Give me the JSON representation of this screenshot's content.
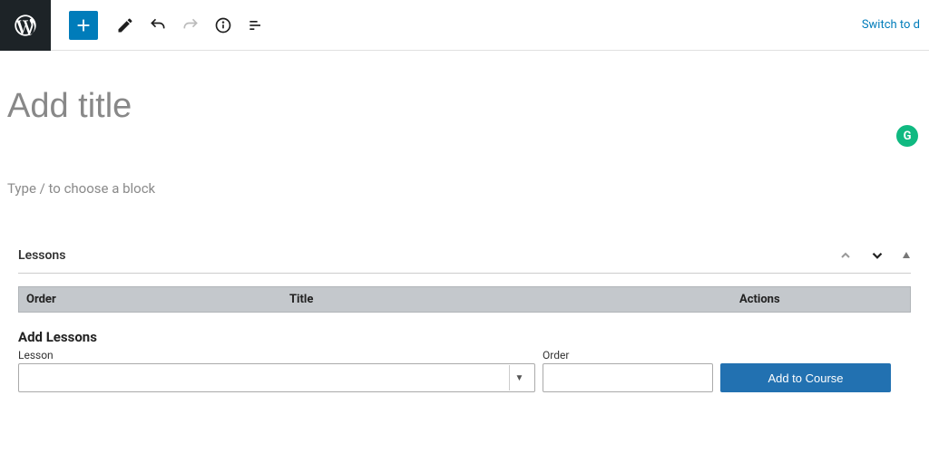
{
  "toolbar": {
    "switch_label": "Switch to d"
  },
  "editor": {
    "title_placeholder": "Add title",
    "block_prompt": "Type / to choose a block"
  },
  "grammarly": {
    "letter": "G"
  },
  "panel": {
    "title": "Lessons",
    "table": {
      "col_order": "Order",
      "col_title": "Title",
      "col_actions": "Actions"
    },
    "add": {
      "heading": "Add Lessons",
      "lesson_label": "Lesson",
      "order_label": "Order",
      "button_label": "Add to Course"
    }
  }
}
